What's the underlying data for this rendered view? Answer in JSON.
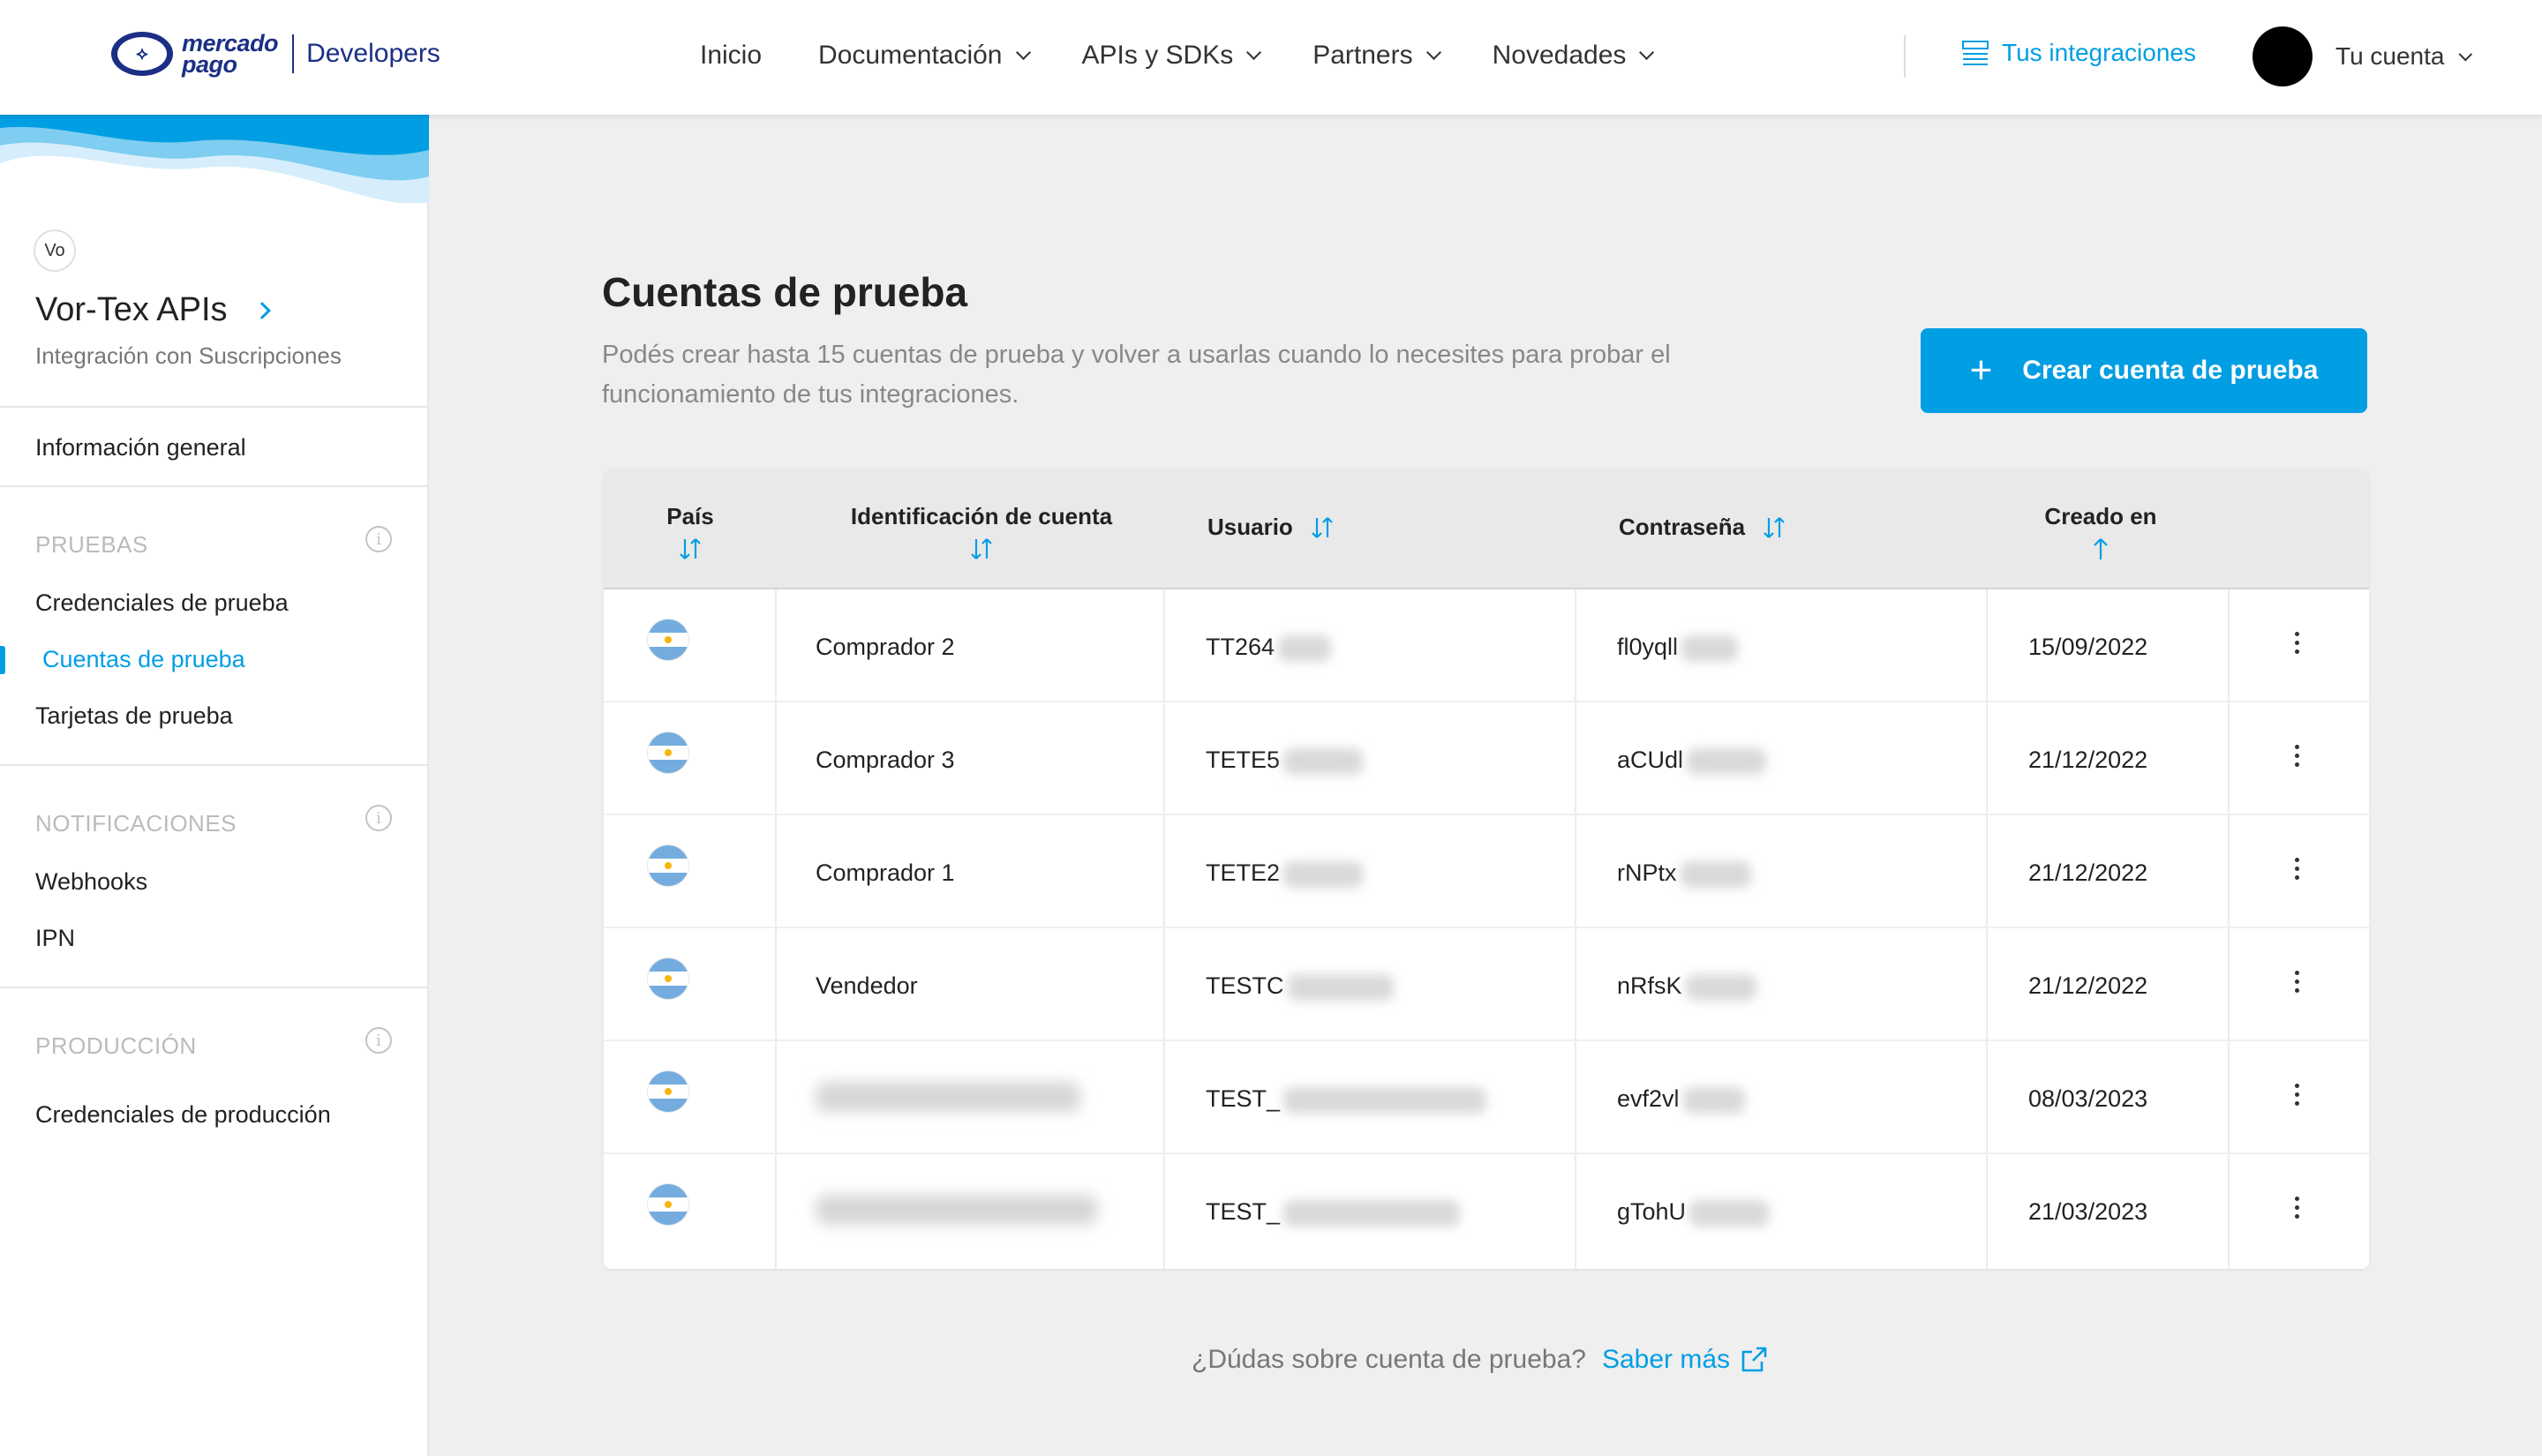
{
  "brand": {
    "logo_line1": "mercado",
    "logo_line2": "pago",
    "product": "Developers"
  },
  "nav": {
    "inicio": "Inicio",
    "documentacion": "Documentación",
    "apis": "APIs y SDKs",
    "partners": "Partners",
    "novedades": "Novedades",
    "integraciones": "Tus integraciones",
    "cuenta": "Tu cuenta"
  },
  "sidebar": {
    "app_initials": "Vo",
    "app_name": "Vor-Tex APIs",
    "app_type": "Integración con Suscripciones",
    "general": "Información general",
    "sections": [
      {
        "title": "PRUEBAS",
        "items": [
          "Credenciales de prueba",
          "Cuentas de prueba",
          "Tarjetas de prueba"
        ]
      },
      {
        "title": "NOTIFICACIONES",
        "items": [
          "Webhooks",
          "IPN"
        ]
      },
      {
        "title": "PRODUCCIÓN",
        "items": [
          "Credenciales de producción"
        ]
      }
    ],
    "active_item": "Cuentas de prueba"
  },
  "main": {
    "title": "Cuentas de prueba",
    "description": "Podés crear hasta 15 cuentas de prueba y volver a usarlas cuando lo necesites para probar el funcionamiento de tus integraciones.",
    "create_button": "Crear cuenta de prueba"
  },
  "table": {
    "headers": {
      "pais": "País",
      "identificacion": "Identificación de cuenta",
      "usuario": "Usuario",
      "contrasena": "Contraseña",
      "creado": "Creado en"
    },
    "rows": [
      {
        "country": "AR",
        "id": "Comprador 2",
        "user": "TT264",
        "password": "fl0yqll",
        "created": "15/09/2022"
      },
      {
        "country": "AR",
        "id": "Comprador 3",
        "user": "TETE5",
        "password": "aCUdl",
        "created": "21/12/2022"
      },
      {
        "country": "AR",
        "id": "Comprador 1",
        "user": "TETE2",
        "password": "rNPtx",
        "created": "21/12/2022"
      },
      {
        "country": "AR",
        "id": "Vendedor",
        "user": "TESTC",
        "password": "nRfsK",
        "created": "21/12/2022"
      },
      {
        "country": "AR",
        "id": "",
        "user": "TEST_",
        "password": "evf2vl",
        "created": "08/03/2023"
      },
      {
        "country": "AR",
        "id": "",
        "user": "TEST_",
        "password": "gTohU",
        "created": "21/03/2023"
      }
    ]
  },
  "footer": {
    "question": "¿Dúdas sobre cuenta de prueba?",
    "link": "Saber más"
  },
  "colors": {
    "accent": "#009ee3",
    "brand": "#1b2f85",
    "background": "#efefef"
  },
  "icons": [
    "handshake-logo-icon",
    "chevron-down-icon",
    "integrations-icon",
    "chevron-right-icon",
    "info-icon",
    "sort-icon",
    "sort-asc-icon",
    "plus-icon",
    "argentina-flag-icon",
    "kebab-menu-icon",
    "external-link-icon"
  ]
}
